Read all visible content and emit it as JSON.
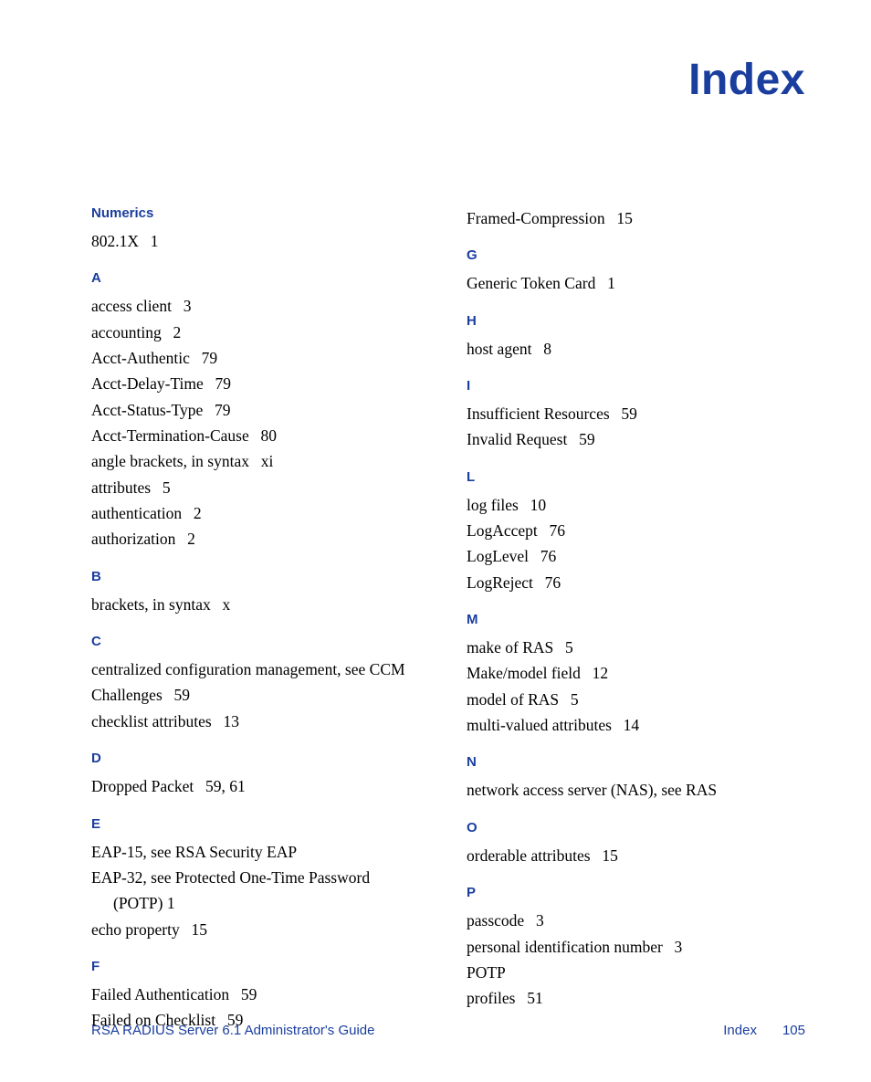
{
  "title": "Index",
  "footer": {
    "left": "RSA RADIUS Server 6.1 Administrator's Guide",
    "section": "Index",
    "page": "105"
  },
  "left_column": [
    {
      "head": "Numerics",
      "entries": [
        {
          "text": "802.1X",
          "pages": "1"
        }
      ]
    },
    {
      "head": "A",
      "entries": [
        {
          "text": "access client",
          "pages": "3"
        },
        {
          "text": "accounting",
          "pages": "2"
        },
        {
          "text": "Acct-Authentic",
          "pages": "79"
        },
        {
          "text": "Acct-Delay-Time",
          "pages": "79"
        },
        {
          "text": "Acct-Status-Type",
          "pages": "79"
        },
        {
          "text": "Acct-Termination-Cause",
          "pages": "80"
        },
        {
          "text": "angle brackets, in syntax",
          "pages": "xi"
        },
        {
          "text": "attributes",
          "pages": "5"
        },
        {
          "text": "authentication",
          "pages": "2"
        },
        {
          "text": "authorization",
          "pages": "2"
        }
      ]
    },
    {
      "head": "B",
      "entries": [
        {
          "text": "brackets, in syntax",
          "pages": "x"
        }
      ]
    },
    {
      "head": "C",
      "entries": [
        {
          "text": "centralized configuration management, see CCM",
          "pages": ""
        },
        {
          "text": "Challenges",
          "pages": "59"
        },
        {
          "text": "checklist attributes",
          "pages": "13"
        }
      ]
    },
    {
      "head": "D",
      "entries": [
        {
          "text": "Dropped Packet",
          "pages": "59, 61"
        }
      ]
    },
    {
      "head": "E",
      "entries": [
        {
          "text": "EAP-15, see RSA Security EAP",
          "pages": ""
        },
        {
          "text": "EAP-32, see Protected One-Time Password",
          "pages": "",
          "sub": "(POTP)  1"
        },
        {
          "text": "echo property",
          "pages": "15"
        }
      ]
    },
    {
      "head": "F",
      "entries": [
        {
          "text": "Failed Authentication",
          "pages": "59"
        },
        {
          "text": "Failed on Checklist",
          "pages": "59"
        }
      ]
    }
  ],
  "right_column": [
    {
      "head": "",
      "entries": [
        {
          "text": "Framed-Compression",
          "pages": "15"
        }
      ]
    },
    {
      "head": "G",
      "entries": [
        {
          "text": "Generic Token Card",
          "pages": "1"
        }
      ]
    },
    {
      "head": "H",
      "entries": [
        {
          "text": "host agent",
          "pages": "8"
        }
      ]
    },
    {
      "head": "I",
      "entries": [
        {
          "text": "Insufficient Resources",
          "pages": "59"
        },
        {
          "text": "Invalid Request",
          "pages": "59"
        }
      ]
    },
    {
      "head": "L",
      "entries": [
        {
          "text": "log files",
          "pages": "10"
        },
        {
          "text": "LogAccept",
          "pages": "76"
        },
        {
          "text": "LogLevel",
          "pages": "76"
        },
        {
          "text": "LogReject",
          "pages": "76"
        }
      ]
    },
    {
      "head": "M",
      "entries": [
        {
          "text": "make of RAS",
          "pages": "5"
        },
        {
          "text": "Make/model field",
          "pages": "12"
        },
        {
          "text": "model of RAS",
          "pages": "5"
        },
        {
          "text": "multi-valued attributes",
          "pages": "14"
        }
      ]
    },
    {
      "head": "N",
      "entries": [
        {
          "text": "network access server (NAS), see RAS",
          "pages": ""
        }
      ]
    },
    {
      "head": "O",
      "entries": [
        {
          "text": "orderable attributes",
          "pages": "15"
        }
      ]
    },
    {
      "head": "P",
      "entries": [
        {
          "text": "passcode",
          "pages": "3"
        },
        {
          "text": "personal identification number",
          "pages": "3"
        },
        {
          "text": "POTP",
          "pages": ""
        },
        {
          "text": "profiles",
          "pages": "51"
        }
      ]
    }
  ]
}
